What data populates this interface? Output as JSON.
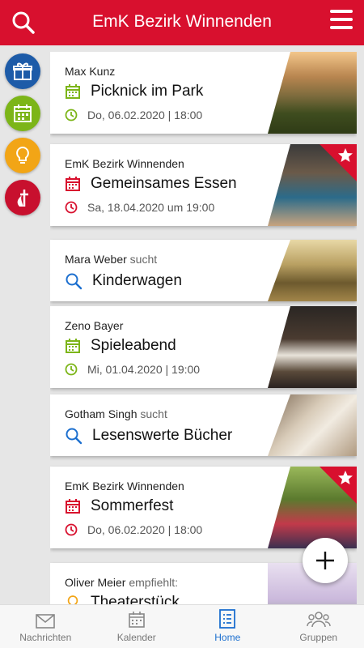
{
  "header": {
    "title": "EmK Bezirk Winnenden"
  },
  "rail": [
    {
      "name": "gift-icon",
      "color": "#1d5ba8"
    },
    {
      "name": "calendar-icon",
      "color": "#7cb518"
    },
    {
      "name": "lightbulb-icon",
      "color": "#f2a516"
    },
    {
      "name": "church-logo-icon",
      "color": "#c8102e"
    }
  ],
  "cards": [
    {
      "author": "Max Kunz",
      "suffix": "",
      "title": "Picknick im Park",
      "date": "Do, 06.02.2020 | 18:00",
      "kind": "event",
      "accent": "#7cb518",
      "featured": false
    },
    {
      "author": "EmK Bezirk Winnenden",
      "suffix": "",
      "title": "Gemeinsames Essen",
      "date": "Sa, 18.04.2020 um 19:00",
      "kind": "event",
      "accent": "#d8102e",
      "featured": true
    },
    {
      "author": "Mara Weber",
      "suffix": "sucht",
      "title": "Kinderwagen",
      "kind": "search",
      "accent": "#1c6fcf"
    },
    {
      "author": "Zeno Bayer",
      "suffix": "",
      "title": "Spieleabend",
      "date": "Mi, 01.04.2020 | 19:00",
      "kind": "event",
      "accent": "#7cb518",
      "featured": false
    },
    {
      "author": "Gotham Singh",
      "suffix": "sucht",
      "title": "Lesenswerte Bücher",
      "kind": "search",
      "accent": "#1c6fcf"
    },
    {
      "author": "EmK Bezirk Winnenden",
      "suffix": "",
      "title": "Sommerfest",
      "date": "Do, 06.02.2020 | 18:00",
      "kind": "event",
      "accent": "#d8102e",
      "featured": true
    },
    {
      "author": "Oliver Meier",
      "suffix": "empfiehlt:",
      "title": "Theaterstück",
      "kind": "tip",
      "accent": "#f2a516"
    }
  ],
  "nav": [
    {
      "label": "Nachrichten",
      "icon": "envelope-icon",
      "active": false
    },
    {
      "label": "Kalender",
      "icon": "calendar-icon",
      "active": false
    },
    {
      "label": "Home",
      "icon": "list-icon",
      "active": true
    },
    {
      "label": "Gruppen",
      "icon": "people-icon",
      "active": false
    }
  ]
}
